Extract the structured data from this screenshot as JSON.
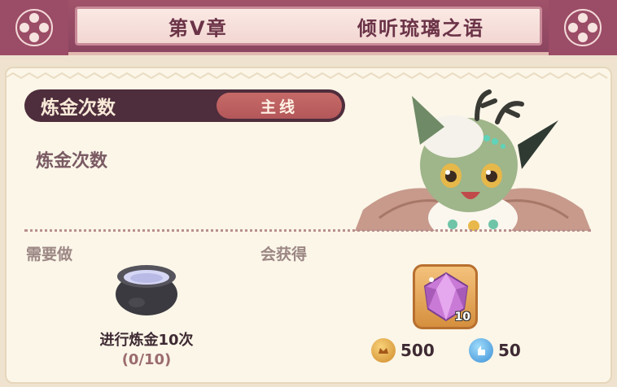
{
  "header": {
    "chapter": "第V章",
    "title": "倾听琉璃之语"
  },
  "task": {
    "name": "炼金次数",
    "tag": "主线",
    "description": "炼金次数"
  },
  "requirements": {
    "label": "需要做",
    "item_text": "进行炼金10次",
    "progress_text": "(0/10)",
    "progress": 0
  },
  "rewards": {
    "label": "会获得",
    "item_count": "10",
    "gold": "500",
    "exp": "50"
  },
  "colors": {
    "header_bg": "#8c4560",
    "pill_bg": "#4e2d3c",
    "tag_bg": "#b3575a",
    "panel_bg": "#fbf6e8"
  }
}
